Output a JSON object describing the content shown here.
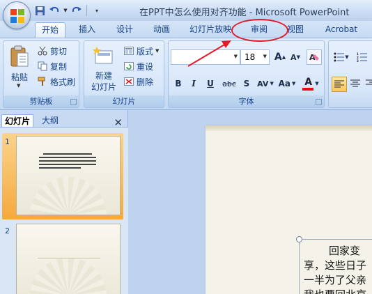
{
  "window": {
    "title": "在PPT中怎么使用对齐功能 - Microsoft PowerPoint"
  },
  "tabs": [
    "开始",
    "插入",
    "设计",
    "动画",
    "幻灯片放映",
    "审阅",
    "视图",
    "Acrobat"
  ],
  "ribbon": {
    "clipboard": {
      "paste": "粘贴",
      "cut": "剪切",
      "copy": "复制",
      "format_painter": "格式刷",
      "label": "剪贴板"
    },
    "slides": {
      "new_slide_line1": "新建",
      "new_slide_line2": "幻灯片",
      "layout": "版式",
      "reset": "重设",
      "delete": "删除",
      "label": "幻灯片"
    },
    "font": {
      "font_name": "",
      "font_size": "18",
      "bold": "B",
      "italic": "I",
      "underline": "U",
      "strike": "abc",
      "shadow": "S",
      "spacing": "AV",
      "case": "Aa",
      "color_letter": "A",
      "grow": "A",
      "shrink": "A",
      "label": "字体"
    }
  },
  "left_pane": {
    "tab_slides": "幻灯片",
    "tab_outline": "大纲",
    "close": "✕",
    "slide1_num": "1",
    "slide2_num": "2"
  },
  "slide": {
    "line1": "回家变",
    "line2": "享，这些日子",
    "line3": "一半为了父亲",
    "line4": "我也要回北京"
  },
  "colors": {
    "accent": "#15428b",
    "annotation": "#e21b2b",
    "selection": "#f5a93d"
  }
}
